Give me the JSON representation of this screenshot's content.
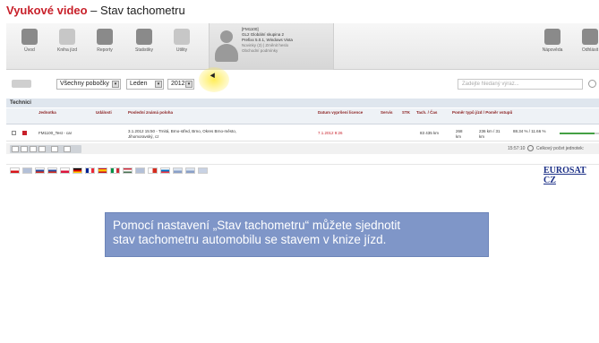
{
  "title": {
    "highlight": "Vyukové video",
    "separator": " – ",
    "rest": "Stav tachometru"
  },
  "toolbar": {
    "buttons": [
      {
        "label": "Úvod",
        "icon": "home-icon"
      },
      {
        "label": "Kniha jízd",
        "icon": "logbook-icon"
      },
      {
        "label": "Reporty",
        "icon": "reports-icon"
      },
      {
        "label": "Statistiky",
        "icon": "statistics-icon"
      },
      {
        "label": "Utility",
        "icon": "utility-icon"
      },
      {
        "label": "Nápověda",
        "icon": "help-icon"
      },
      {
        "label": "Odhlásit",
        "icon": "logout-icon"
      }
    ],
    "user": {
      "line1": "[FM1100]",
      "line2": "GL2 Globální skupina 2",
      "line3": "Prefixx 5.0.1, Windows Vista",
      "line4": "Novinky (3) | Změnit heslo",
      "line5": "Obchodní podmínky"
    }
  },
  "filters": {
    "branch": "Všechny pobočky",
    "month": "Leden",
    "year": "2012",
    "search_placeholder": "Zadejte hledaný výraz..."
  },
  "section": {
    "title": "Technici"
  },
  "table": {
    "headers": [
      "Jednotka",
      "Události",
      "Poslední známá poloha",
      "Datum vypršení licence",
      "Servis",
      "STK",
      "Tach. / Čas",
      "Poměr typů jízd / Poměr vstupů"
    ],
    "rows": [
      {
        "unit": "FM1100_Test - car",
        "position_line1": "3.1.2012 15:50 - Trnitá, Brno-střed, Brno, Okres Brno-město,",
        "position_line2": "Jihomoravský, cz",
        "license": "7.1.2012 9:26",
        "tach": "83 435 km",
        "dist": "268 km",
        "ratio1": "236 km / 31 km",
        "ratio2": "88.34 % / 11.66 %",
        "progress": 0.88
      }
    ]
  },
  "footer": {
    "time": "15:57:10",
    "total": "Celkový počet jednotek:"
  },
  "brand": "EUROSAT CZ",
  "caption": {
    "line1": "Pomocí nastavení „Stav tachometru“ můžete sjednotit",
    "line2": "stav tachometru automobilu se stavem v knize jízd."
  },
  "colors": {
    "accent_red": "#c8202a",
    "caption_bg": "#7f96c8",
    "brand_blue": "#1b2f86"
  }
}
